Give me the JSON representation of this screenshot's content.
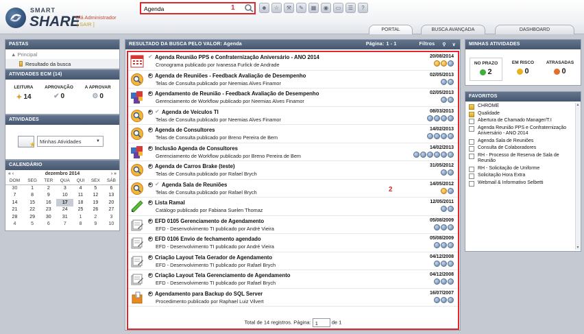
{
  "header": {
    "logo_small": "SMART",
    "logo_big": "SHARE",
    "greeting": "Olá Administrador",
    "logout": "[ SAIR ]",
    "search_value": "Agenda",
    "search_marker": "1",
    "toolbar_icons": [
      "user-icon",
      "star-icon",
      "tools-icon",
      "wrench-icon",
      "calculator-icon",
      "record-icon",
      "monitor-icon",
      "list-icon",
      "help-icon"
    ]
  },
  "tabs": [
    {
      "label": "PORTAL"
    },
    {
      "label": "BUSCA AVANÇADA"
    },
    {
      "label": "DASHBOARD"
    }
  ],
  "left": {
    "pastas": {
      "title": "PASTAS",
      "principal": "Principal",
      "resultado": "Resultado da busca"
    },
    "ecm": {
      "title": "ATIVIDADES ECM (14)",
      "cols": [
        {
          "label": "LEITURA",
          "value": "14"
        },
        {
          "label": "APROVAÇÃO",
          "value": "0"
        },
        {
          "label": "A APROVAR",
          "value": "0"
        }
      ]
    },
    "atividades": {
      "title": "ATIVIDADES",
      "select_value": "Minhas Atividades"
    },
    "calendario": {
      "title": "CALENDÁRIO",
      "month": "dezembro 2014",
      "prev": "« ‹",
      "next": "› »",
      "days": [
        "DOM",
        "SEG",
        "TER",
        "QUA",
        "QUI",
        "SEX",
        "SÁB"
      ],
      "weeks": [
        [
          "30",
          "1",
          "2",
          "3",
          "4",
          "5",
          "6"
        ],
        [
          "7",
          "8",
          "9",
          "10",
          "11",
          "12",
          "13"
        ],
        [
          "14",
          "15",
          "16",
          "17",
          "18",
          "19",
          "20"
        ],
        [
          "21",
          "22",
          "23",
          "24",
          "25",
          "26",
          "27"
        ],
        [
          "28",
          "29",
          "30",
          "31",
          "1",
          "2",
          "3"
        ],
        [
          "4",
          "5",
          "6",
          "7",
          "8",
          "9",
          "10"
        ]
      ],
      "today": "17"
    }
  },
  "center": {
    "header_title": "RESULTADO DA BUSCA PELO VALOR: Agenda",
    "page_label": "Página:",
    "page_value": "1 - 1",
    "filtros": "Filtros",
    "marker": "2",
    "results": [
      {
        "title": "Agenda Reunião PPS e Confraternização Aniversário - ANO 2014",
        "sub": "Cronograma publicado por Ivanessa Furlick de Andrade",
        "date": "20/08/2014",
        "icon": "calendar",
        "check": true,
        "arrow": false,
        "acts": [
          "orange",
          "orange",
          "blue"
        ]
      },
      {
        "title": "Agenda de Reuniões - Feedback Avaliação de Desempenho",
        "sub": "Telas de Consulta publicado por Neemias Alves Finamor",
        "date": "02/05/2013",
        "icon": "consulta",
        "check": false,
        "arrow": true,
        "acts": [
          "blue",
          "blue"
        ]
      },
      {
        "title": "Agendamento de Reunião - Feedback Avaliação de Desempenho",
        "sub": "Gerenciamento de Workflow publicado por Neemias Alves Finamor",
        "date": "02/05/2013",
        "icon": "workflow",
        "check": false,
        "arrow": true,
        "acts": [
          "blue",
          "blue"
        ]
      },
      {
        "title": "Agenda de Veículos TI",
        "sub": "Telas de Consulta publicado por Neemias Alves Finamor",
        "date": "08/03/2013",
        "icon": "consulta",
        "check": true,
        "arrow": true,
        "acts": [
          "blue",
          "blue",
          "blue",
          "blue"
        ]
      },
      {
        "title": "Agenda de Consultores",
        "sub": "Telas de Consulta publicado por Breno Pereira de Bem",
        "date": "14/02/2013",
        "icon": "consulta",
        "check": false,
        "arrow": true,
        "acts": [
          "blue",
          "blue",
          "blue",
          "blue"
        ]
      },
      {
        "title": "Inclusão Agenda de Consultores",
        "sub": "Gerenciamento de Workflow publicado por Breno Pereira de Bem",
        "date": "14/02/2013",
        "icon": "workflow",
        "check": false,
        "arrow": true,
        "acts": [
          "blue",
          "blue",
          "blue",
          "blue",
          "blue",
          "blue"
        ]
      },
      {
        "title": "Agenda de Carros Brake (teste)",
        "sub": "Telas de Consulta publicado por Rafael Brych",
        "date": "31/05/2012",
        "icon": "consulta",
        "check": false,
        "arrow": true,
        "acts": [
          "blue",
          "blue"
        ]
      },
      {
        "title": "Agenda Sala de Reuniões",
        "sub": "Telas de Consulta publicado por Rafael Brych",
        "date": "14/05/2012",
        "icon": "consulta",
        "check": true,
        "arrow": true,
        "acts": [
          "orange",
          "blue"
        ]
      },
      {
        "title": "Lista Ramal",
        "sub": "Catálogo publicado por Fabiana Suelen Thomaz",
        "date": "12/05/2011",
        "icon": "catalog",
        "check": false,
        "arrow": true,
        "acts": [
          "blue",
          "blue"
        ]
      },
      {
        "title": "EFD 0105 Gerenciamento de Agendamento",
        "sub": "EFD - Desenvolvimento TI publicado por André Vieira",
        "date": "05/08/2009",
        "icon": "efd",
        "check": false,
        "arrow": true,
        "acts": [
          "blue",
          "blue",
          "blue"
        ]
      },
      {
        "title": "EFD 0106 Envio de fechamento agendado",
        "sub": "EFD - Desenvolvimento TI publicado por André Vieira",
        "date": "05/08/2009",
        "icon": "efd",
        "check": false,
        "arrow": true,
        "acts": [
          "blue",
          "blue",
          "blue"
        ]
      },
      {
        "title": "Criação Layout Tela Gerador de Agendamento",
        "sub": "EFD - Desenvolvimento TI publicado por Rafael Brych",
        "date": "04/12/2008",
        "icon": "efd",
        "check": false,
        "arrow": true,
        "acts": [
          "blue",
          "blue",
          "blue"
        ]
      },
      {
        "title": "Criação Layout Tela Gerenciamento de Agendamento",
        "sub": "EFD - Desenvolvimento TI publicado por Rafael Brych",
        "date": "04/12/2008",
        "icon": "efd",
        "check": false,
        "arrow": true,
        "acts": [
          "blue",
          "blue",
          "blue"
        ]
      },
      {
        "title": "Agendamento para Backup do SQL Server",
        "sub": "Procedimento publicado por Raphael Luiz Vilvert",
        "date": "16/07/2007",
        "icon": "proc",
        "check": false,
        "arrow": true,
        "acts": [
          "blue",
          "blue",
          "blue"
        ]
      }
    ],
    "footer_total": "Total de 14 registros. Página:",
    "footer_page": "1",
    "footer_of": "de 1"
  },
  "right": {
    "minhas": {
      "title": "MINHAS ATIVIDADES",
      "cols": [
        {
          "label": "NO PRAZO",
          "value": "2",
          "color": "#3fae3f"
        },
        {
          "label": "EM RISCO",
          "value": "0",
          "color": "#e9b320"
        },
        {
          "label": "ATRASADAS",
          "value": "0",
          "color": "#e2702b"
        }
      ]
    },
    "favoritos": {
      "title": "FAVORITOS",
      "items": [
        {
          "label": "CHROME",
          "type": "folder"
        },
        {
          "label": "Qualidade",
          "type": "folder"
        },
        {
          "label": "Abertura de Chamado Manager/T.I",
          "type": "page"
        },
        {
          "label": "Agenda Reunião PPS e Confraternização Aniversário - ANO 2014",
          "type": "page"
        },
        {
          "label": "Agenda Sala de Reuniões",
          "type": "page"
        },
        {
          "label": "Consulta de Colaboradores",
          "type": "page"
        },
        {
          "label": "RH - Processo de Reserva de Sala de Reunião",
          "type": "page"
        },
        {
          "label": "RH - Solicitação de Uniforme",
          "type": "page"
        },
        {
          "label": "Solicitação Hora Extra",
          "type": "page"
        },
        {
          "label": "Webmail & Informativo Selbetti",
          "type": "page"
        }
      ]
    }
  }
}
